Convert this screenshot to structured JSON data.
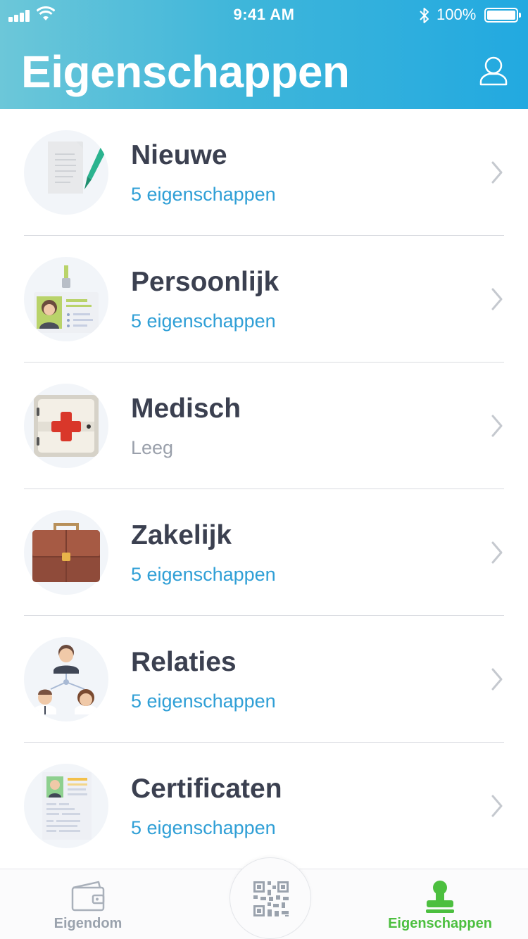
{
  "status_bar": {
    "time": "9:41 AM",
    "battery": "100%"
  },
  "header": {
    "title": "Eigenschappen"
  },
  "categories": [
    {
      "title": "Nieuwe",
      "subtitle": "5 eigenschappen",
      "icon": "document-pen-icon"
    },
    {
      "title": "Persoonlijk",
      "subtitle": "5 eigenschappen",
      "icon": "id-badge-icon"
    },
    {
      "title": "Medisch",
      "subtitle": "Leeg",
      "icon": "medical-kit-icon"
    },
    {
      "title": "Zakelijk",
      "subtitle": "5 eigenschappen",
      "icon": "briefcase-icon"
    },
    {
      "title": "Relaties",
      "subtitle": "5 eigenschappen",
      "icon": "people-network-icon"
    },
    {
      "title": "Certificaten",
      "subtitle": "5 eigenschappen",
      "icon": "certificate-icon"
    }
  ],
  "tab_bar": {
    "tabs": [
      {
        "label": "Eigendom",
        "icon": "wallet-icon",
        "active": false
      },
      {
        "label": "Eigenschappen",
        "icon": "stamp-icon",
        "active": true
      }
    ],
    "center_button_icon": "qr-code-icon"
  },
  "colors": {
    "header_gradient_start": "#6cc7d9",
    "header_gradient_end": "#22a9e0",
    "subtitle_blue": "#2f9fd6",
    "active_tab_green": "#4cbf3f",
    "inactive_tab_gray": "#9aa2ad"
  }
}
